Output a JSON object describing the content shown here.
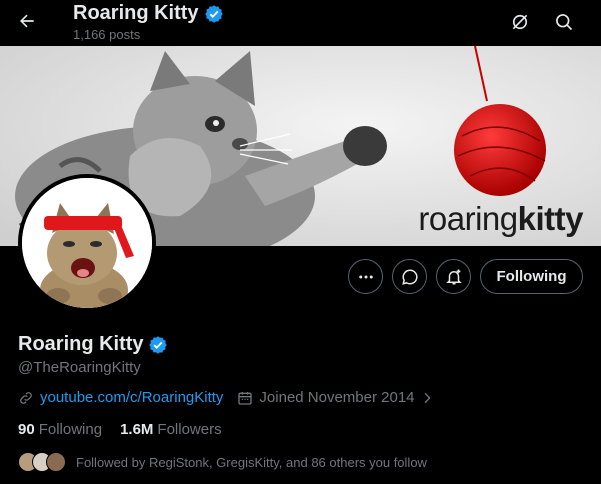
{
  "header": {
    "title": "Roaring Kitty",
    "posts_count": "1,166 posts",
    "icons": [
      "back-arrow-icon",
      "grok-icon",
      "search-icon"
    ]
  },
  "banner": {
    "text_light": "roaring",
    "text_bold": "kitty"
  },
  "profile": {
    "display_name": "Roaring Kitty",
    "handle": "@TheRoaringKitty",
    "website": "youtube.com/c/RoaringKitty",
    "joined": "Joined November 2014",
    "following_count": "90",
    "following_label": "Following",
    "followers_count": "1.6M",
    "followers_label": "Followers",
    "followed_by": "Followed by RegiStonk, GregisKitty, and 86 others you follow"
  },
  "actions": {
    "more_icon": "more-icon",
    "message_icon": "message-icon",
    "notify_icon": "notify-bell-icon",
    "follow_label": "Following"
  },
  "colors": {
    "background": "#000000",
    "text_primary": "#e7e9ea",
    "text_secondary": "#71767b",
    "link": "#1d9bf0",
    "verified": "#1d9bf0",
    "border": "#536471"
  }
}
